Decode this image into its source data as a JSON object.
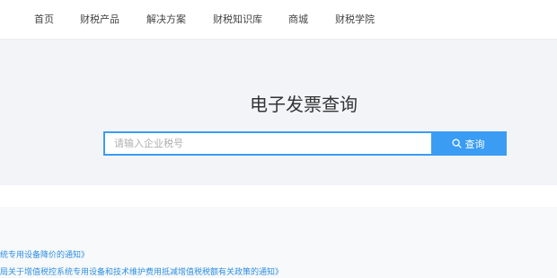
{
  "nav": {
    "items": [
      {
        "label": "首页"
      },
      {
        "label": "财税产品"
      },
      {
        "label": "解决方案"
      },
      {
        "label": "财税知识库"
      },
      {
        "label": "商城"
      },
      {
        "label": "财税学院"
      }
    ]
  },
  "hero": {
    "title": "电子发票查询",
    "search": {
      "placeholder": "请输入企业税号",
      "value": "",
      "button_label": "查询",
      "button_icon": "search-icon"
    }
  },
  "news": {
    "links": [
      {
        "text": "统专用设备降价的通知》"
      },
      {
        "text": "局关于增值税控系统专用设备和技术维护费用抵减增值税税额有关政策的通知》"
      }
    ]
  },
  "colors": {
    "accent": "#3a9cf3",
    "link": "#2f8fe0",
    "hero_bg": "#f2f4f8"
  }
}
